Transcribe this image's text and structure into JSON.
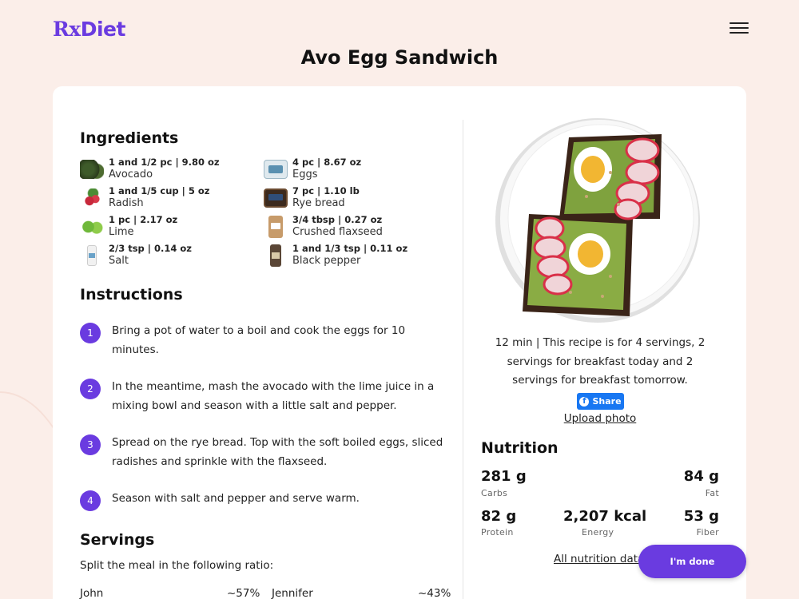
{
  "app": {
    "logo_rx": "Rx",
    "logo_diet": "Diet"
  },
  "page": {
    "title": "Avo Egg Sandwich"
  },
  "ingredients": {
    "heading": "Ingredients",
    "items": [
      {
        "qty": "1 and 1/2 pc | 9.80 oz",
        "name": "Avocado",
        "icon": "avocado-icon"
      },
      {
        "qty": "4 pc | 8.67 oz",
        "name": "Eggs",
        "icon": "eggs-icon"
      },
      {
        "qty": "1 and 1/5 cup | 5 oz",
        "name": "Radish",
        "icon": "radish-icon"
      },
      {
        "qty": "7 pc | 1.10 lb",
        "name": "Rye bread",
        "icon": "rye-bread-icon"
      },
      {
        "qty": "1 pc | 2.17 oz",
        "name": "Lime",
        "icon": "lime-icon"
      },
      {
        "qty": "3/4 tbsp | 0.27 oz",
        "name": "Crushed flaxseed",
        "icon": "flaxseed-icon"
      },
      {
        "qty": "2/3 tsp | 0.14 oz",
        "name": "Salt",
        "icon": "salt-icon"
      },
      {
        "qty": "1 and 1/3 tsp | 0.11 oz",
        "name": "Black pepper",
        "icon": "pepper-icon"
      }
    ]
  },
  "instructions": {
    "heading": "Instructions",
    "steps": [
      {
        "num": "1",
        "text": "Bring a pot of water to a boil and cook the eggs for 10 minutes."
      },
      {
        "num": "2",
        "text": "In the meantime, mash the avocado with the lime juice in a mixing bowl and season with a little salt and pepper."
      },
      {
        "num": "3",
        "text": "Spread on the rye bread. Top with the soft boiled eggs, sliced radishes and sprinkle with the flaxseed."
      },
      {
        "num": "4",
        "text": "Season with salt and pepper and serve warm."
      }
    ]
  },
  "servings": {
    "heading": "Servings",
    "subtitle": "Split the meal in the following ratio:",
    "people": [
      {
        "name": "John",
        "ratio": "~57%"
      },
      {
        "name": "Jennifer",
        "ratio": "~43%"
      }
    ]
  },
  "recipe_meta": {
    "info": "12 min | This recipe is for 4 servings, 2 servings for breakfast today and 2 servings for breakfast tomorrow.",
    "share_label": "Share",
    "upload_label": "Upload photo"
  },
  "nutrition": {
    "heading": "Nutrition",
    "carbs_value": "281 g",
    "carbs_label": "Carbs",
    "fat_value": "84 g",
    "fat_label": "Fat",
    "protein_value": "82 g",
    "protein_label": "Protein",
    "energy_value": "2,207 kcal",
    "energy_label": "Energy",
    "fiber_value": "53 g",
    "fiber_label": "Fiber",
    "all_link": "All nutrition data"
  },
  "actions": {
    "done_label": "I'm done"
  },
  "colors": {
    "brand": "#6a3be0",
    "background": "#fbeee9",
    "facebook": "#1877f2"
  }
}
